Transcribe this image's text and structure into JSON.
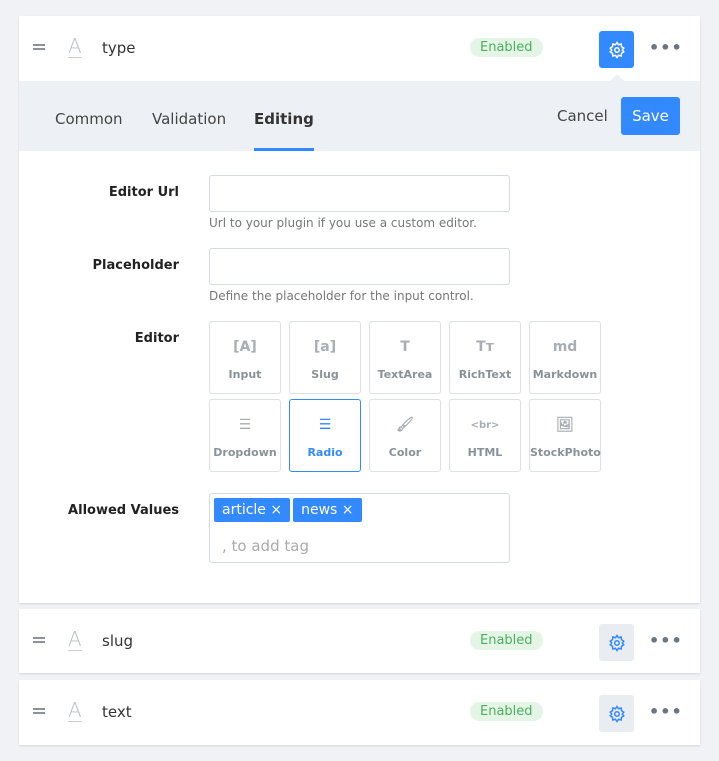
{
  "fields": [
    {
      "name": "type",
      "status": "Enabled"
    },
    {
      "name": "slug",
      "status": "Enabled"
    },
    {
      "name": "text",
      "status": "Enabled"
    }
  ],
  "tabs": [
    "Common",
    "Validation",
    "Editing"
  ],
  "active_tab": "Editing",
  "actions": {
    "cancel": "Cancel",
    "save": "Save"
  },
  "form": {
    "editor_url": {
      "label": "Editor Url",
      "value": "",
      "hint": "Url to your plugin if you use a custom editor."
    },
    "placeholder": {
      "label": "Placeholder",
      "value": "",
      "hint": "Define the placeholder for the input control."
    },
    "editor": {
      "label": "Editor",
      "options": [
        "Input",
        "Slug",
        "TextArea",
        "RichText",
        "Markdown",
        "Dropdown",
        "Radio",
        "Color",
        "HTML",
        "StockPhoto"
      ],
      "selected": "Radio"
    },
    "allowed_values": {
      "label": "Allowed Values",
      "tags": [
        "article",
        "news"
      ],
      "placeholder": ", to add tag"
    }
  },
  "colors": {
    "accent": "#3389ff",
    "enabled": "#4caf60"
  }
}
